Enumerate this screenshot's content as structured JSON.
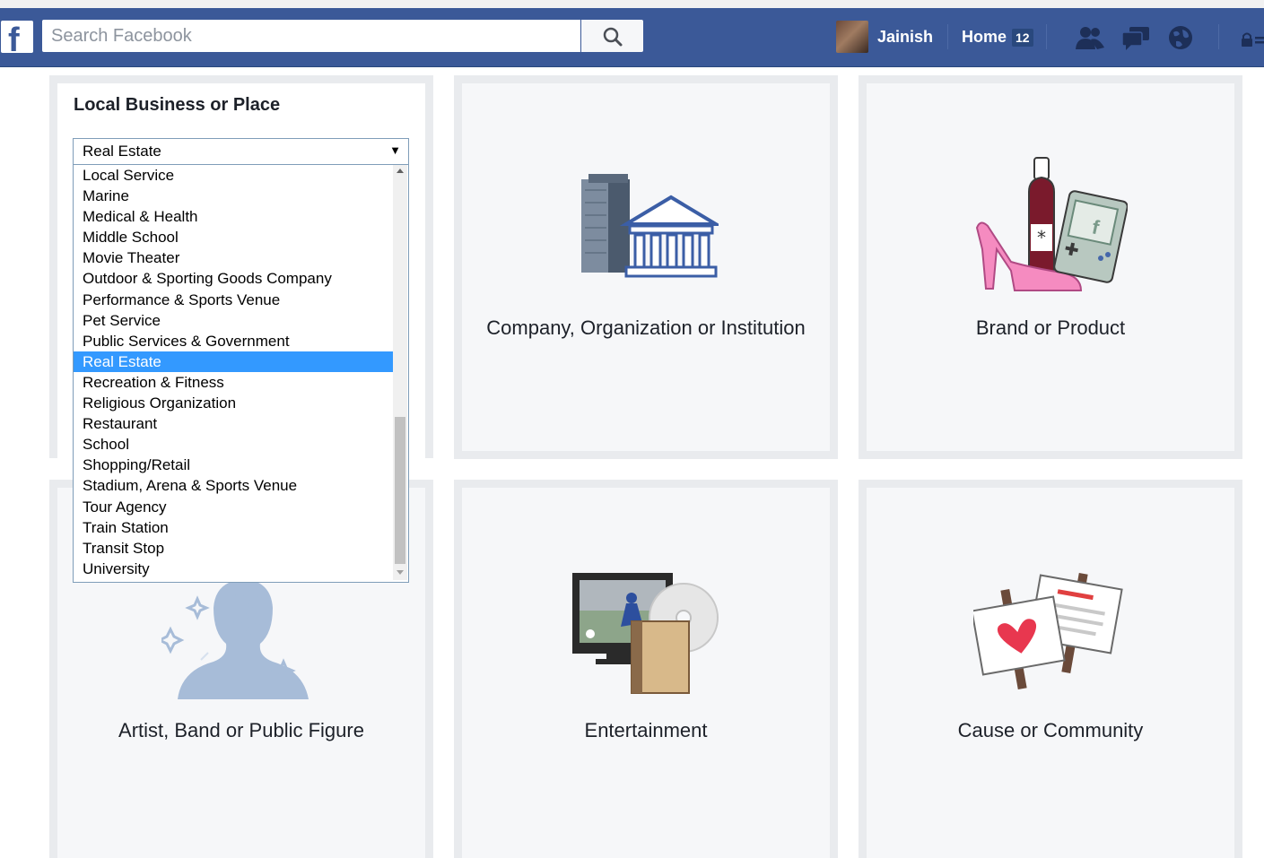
{
  "header": {
    "search_placeholder": "Search Facebook",
    "user_name": "Jainish",
    "home_label": "Home",
    "home_count": "12",
    "brand_color": "#3b5998"
  },
  "local_business": {
    "title": "Local Business or Place",
    "selected": "Real Estate",
    "options": [
      "Local Service",
      "Marine",
      "Medical & Health",
      "Middle School",
      "Movie Theater",
      "Outdoor & Sporting Goods Company",
      "Performance & Sports Venue",
      "Pet Service",
      "Public Services & Government",
      "Real Estate",
      "Recreation & Fitness",
      "Religious Organization",
      "Restaurant",
      "School",
      "Shopping/Retail",
      "Stadium, Arena & Sports Venue",
      "Tour Agency",
      "Train Station",
      "Transit Stop",
      "University"
    ],
    "highlight_color": "#3399ff"
  },
  "cards": {
    "company": "Company, Organization or Institution",
    "brand": "Brand or Product",
    "artist": "Artist, Band or Public Figure",
    "entertainment": "Entertainment",
    "cause": "Cause or Community"
  }
}
